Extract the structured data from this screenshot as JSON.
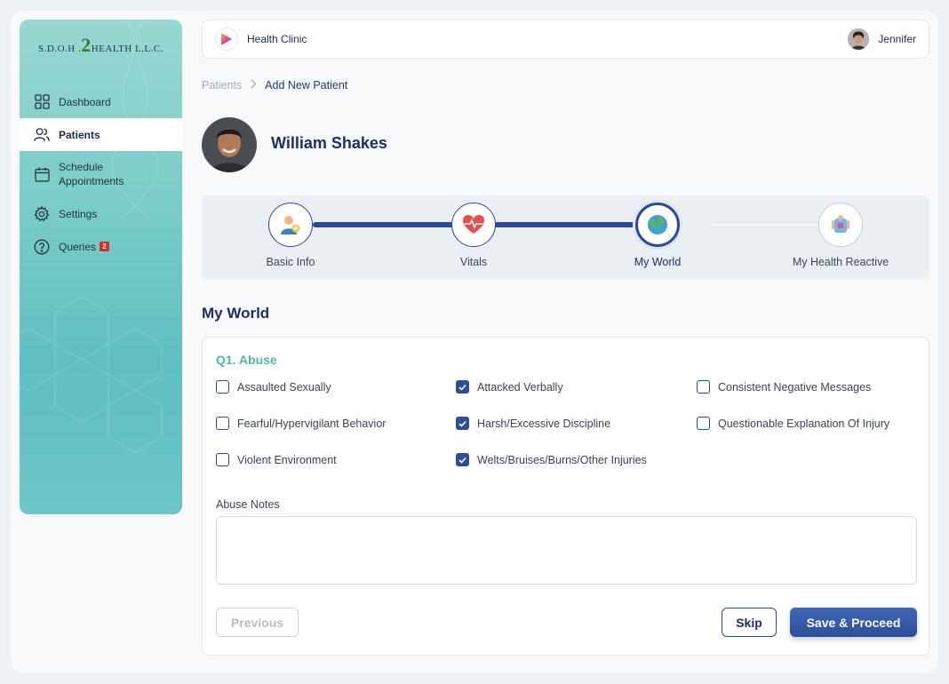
{
  "sidebar": {
    "logo": {
      "prefix": "S.D.O.H .",
      "two": "2",
      "suffix": "HEALTH L.L.C."
    },
    "items": [
      {
        "label": "Dashboard",
        "icon": "grid-icon"
      },
      {
        "label": "Patients",
        "icon": "users-icon",
        "active": true
      },
      {
        "label": "Schedule Appointments",
        "icon": "calendar-icon"
      },
      {
        "label": "Settings",
        "icon": "gear-icon"
      },
      {
        "label": "Queries",
        "icon": "help-circle-icon",
        "badge": "2"
      }
    ]
  },
  "header": {
    "title": "Health Clinic",
    "user_name": "Jennifer"
  },
  "breadcrumb": {
    "parent": "Patients",
    "current": "Add New Patient"
  },
  "patient": {
    "name": "William Shakes"
  },
  "stepper": {
    "steps": [
      {
        "label": "Basic Info",
        "icon": "user-add-icon",
        "state": "done"
      },
      {
        "label": "Vitals",
        "icon": "heartbeat-icon",
        "state": "done"
      },
      {
        "label": "My World",
        "icon": "globe-icon",
        "state": "current"
      },
      {
        "label": "My Health Reactive",
        "icon": "body-icon",
        "state": "future"
      }
    ]
  },
  "section": {
    "title": "My World"
  },
  "question": {
    "title": "Q1. Abuse",
    "options": [
      {
        "label": "Assaulted Sexually",
        "checked": false
      },
      {
        "label": "Attacked Verbally",
        "checked": true
      },
      {
        "label": "Consistent Negative Messages",
        "checked": false
      },
      {
        "label": "Fearful/Hypervigilant Behavior",
        "checked": false
      },
      {
        "label": "Harsh/Excessive Discipline",
        "checked": true
      },
      {
        "label": "Questionable Explanation Of Injury",
        "checked": false
      },
      {
        "label": "Violent Environment",
        "checked": false
      },
      {
        "label": "Welts/Bruises/Burns/Other Injuries",
        "checked": true
      }
    ],
    "notes_label": "Abuse Notes",
    "notes_value": ""
  },
  "buttons": {
    "previous": "Previous",
    "skip": "Skip",
    "save": "Save & Proceed"
  },
  "colors": {
    "accent": "#2b4a9a",
    "question": "#4dbb9f",
    "sidebar": "#7ccdc8"
  }
}
